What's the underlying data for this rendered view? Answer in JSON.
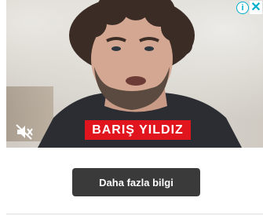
{
  "ad": {
    "speaker_name": "BARIŞ YILDIZ",
    "cta_label": "Daha fazla bilgi",
    "adchoices_label": "i",
    "close_label": "✕",
    "icons": {
      "mute": "speaker-muted-icon",
      "adchoices": "info-icon",
      "close": "close-icon"
    },
    "colors": {
      "banner": "#e1151d",
      "cta_background": "#3a3a3a",
      "adchoices": "#00aecd"
    }
  }
}
